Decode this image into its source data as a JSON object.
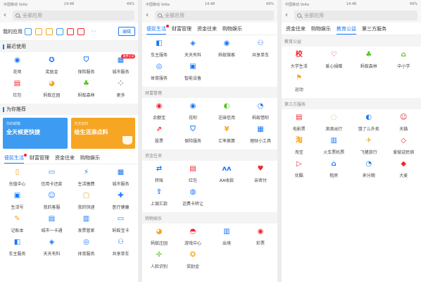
{
  "status": {
    "left": "中国移动 Volte",
    "time": "14:48",
    "right": "49%"
  },
  "search": {
    "placeholder": "全部应用",
    "back_glyph": "‹"
  },
  "panel1": {
    "my_apps": {
      "label": "我的应用",
      "mini_icons": [
        {
          "name": "bank-card-icon",
          "color": "#3d9bf1"
        },
        {
          "name": "transfer-icon",
          "color": "#f6a623"
        },
        {
          "name": "book-icon",
          "color": "#f6a623"
        },
        {
          "name": "card-icon",
          "color": "#3d9bf1"
        },
        {
          "name": "wallet-icon",
          "color": "#f5222d"
        },
        {
          "name": "heart-icon",
          "color": "#f5222d"
        }
      ],
      "more": "···",
      "edit": "编辑"
    },
    "recent": {
      "title": "最近使用",
      "items": [
        {
          "label": "花呗",
          "glyph": "◉",
          "color": "#1677ff",
          "icon": "huabei-icon"
        },
        {
          "label": "奖励金",
          "glyph": "✪",
          "color": "#1677ff",
          "icon": "reward-icon"
        },
        {
          "label": "保险服务",
          "glyph": "⛉",
          "color": "#1677ff",
          "icon": "insurance-shield-icon"
        },
        {
          "label": "城市服务",
          "glyph": "▦",
          "color": "#1677ff",
          "icon": "city-service-icon",
          "badge": "缴费记录"
        },
        {
          "label": "红包",
          "glyph": "▤",
          "color": "#f5222d",
          "icon": "red-packet-icon"
        },
        {
          "label": "蚂蚁庄园",
          "glyph": "◕",
          "color": "#f6a623",
          "icon": "ant-farm-icon"
        },
        {
          "label": "蚂蚁森林",
          "glyph": "♣",
          "color": "#52c41a",
          "icon": "ant-forest-icon"
        },
        {
          "label": "更多",
          "glyph": "⁘",
          "color": "#888888",
          "icon": "more-icon"
        }
      ]
    },
    "recommend": {
      "title": "为你推荐",
      "banners": [
        {
          "small": "你的邮箱",
          "big": "全天候更快捷"
        },
        {
          "small": "天天有料",
          "big": "给生活添点料"
        }
      ]
    },
    "tabs": [
      {
        "label": "便民生活",
        "active": true,
        "dot": true
      },
      {
        "label": "财富管理"
      },
      {
        "label": "资金往来"
      },
      {
        "label": "购物娱乐"
      }
    ],
    "grid": [
      {
        "label": "充值中心",
        "glyph": "▯",
        "color": "#f6a623",
        "icon": "phone-recharge-icon"
      },
      {
        "label": "信用卡还款",
        "glyph": "▭",
        "color": "#1677ff",
        "icon": "credit-card-icon"
      },
      {
        "label": "生活缴费",
        "glyph": "⚡",
        "color": "#1677ff",
        "icon": "utilities-icon"
      },
      {
        "label": "城市服务",
        "glyph": "▦",
        "color": "#1677ff",
        "icon": "city-service-icon"
      },
      {
        "label": "生活号",
        "glyph": "▣",
        "color": "#1677ff",
        "icon": "life-account-icon"
      },
      {
        "label": "我的客服",
        "glyph": "☺",
        "color": "#1677ff",
        "icon": "customer-service-icon"
      },
      {
        "label": "我的快递",
        "glyph": "▢",
        "color": "#f6a623",
        "icon": "express-icon"
      },
      {
        "label": "医疗健康",
        "glyph": "✚",
        "color": "#1677ff",
        "icon": "medical-icon"
      },
      {
        "label": "记账本",
        "glyph": "✎",
        "color": "#f6a623",
        "icon": "ledger-icon"
      },
      {
        "label": "城市一卡通",
        "glyph": "▤",
        "color": "#1677ff",
        "icon": "transit-card-icon"
      },
      {
        "label": "发票管家",
        "glyph": "▥",
        "color": "#1677ff",
        "icon": "invoice-icon"
      },
      {
        "label": "蚂蚁宝卡",
        "glyph": "▭",
        "color": "#1677ff",
        "icon": "ant-card-icon"
      },
      {
        "label": "车主服务",
        "glyph": "◧",
        "color": "#1677ff",
        "icon": "car-service-icon"
      },
      {
        "label": "天天有料",
        "glyph": "◈",
        "color": "#1677ff",
        "icon": "daily-news-icon"
      },
      {
        "label": "体育服务",
        "glyph": "◎",
        "color": "#1677ff",
        "icon": "sports-icon"
      },
      {
        "label": "共享单车",
        "glyph": "⚇",
        "color": "#1677ff",
        "icon": "bike-icon"
      }
    ]
  },
  "panel2": {
    "tabs": [
      {
        "label": "便民生活",
        "active": true,
        "dot": true
      },
      {
        "label": "财富管理"
      },
      {
        "label": "资金往来"
      },
      {
        "label": "购物娱乐"
      }
    ],
    "grid_top": [
      {
        "label": "车主服务",
        "glyph": "◧",
        "color": "#1677ff",
        "icon": "car-service-icon"
      },
      {
        "label": "天天有料",
        "glyph": "◈",
        "color": "#1677ff",
        "icon": "daily-news-icon"
      },
      {
        "label": "蚂蚁微客",
        "glyph": "◉",
        "color": "#1677ff",
        "icon": "ant-guest-icon"
      },
      {
        "label": "共享单车",
        "glyph": "⚇",
        "color": "#1677ff",
        "icon": "bike-icon"
      },
      {
        "label": "体育服务",
        "glyph": "◎",
        "color": "#1677ff",
        "icon": "sports-icon"
      },
      {
        "label": "智能设备",
        "glyph": "▣",
        "color": "#1677ff",
        "icon": "smart-device-icon"
      }
    ],
    "wealth": {
      "title": "财富管理",
      "items": [
        {
          "label": "余额宝",
          "glyph": "◉",
          "color": "#f5222d",
          "icon": "yuebao-icon"
        },
        {
          "label": "花呗",
          "glyph": "◉",
          "color": "#1677ff",
          "icon": "huabei-icon"
        },
        {
          "label": "芝麻信用",
          "glyph": "◐",
          "color": "#52c41a",
          "icon": "sesame-credit-icon"
        },
        {
          "label": "蚂蚁借呗",
          "glyph": "◔",
          "color": "#1677ff",
          "icon": "jiebei-icon"
        },
        {
          "label": "股票",
          "glyph": "⇗",
          "color": "#f5222d",
          "icon": "stock-icon"
        },
        {
          "label": "保险服务",
          "glyph": "⛉",
          "color": "#1677ff",
          "icon": "insurance-shield-icon"
        },
        {
          "label": "汇率换算",
          "glyph": "¥",
          "color": "#f6a623",
          "icon": "exchange-rate-icon"
        },
        {
          "label": "理财小工具",
          "glyph": "▦",
          "color": "#1677ff",
          "icon": "finance-tools-icon"
        }
      ]
    },
    "funds": {
      "title": "资金往来",
      "items": [
        {
          "label": "转账",
          "glyph": "⇄",
          "color": "#1677ff",
          "icon": "transfer-icon"
        },
        {
          "label": "红包",
          "glyph": "▤",
          "color": "#f5222d",
          "icon": "red-packet-icon"
        },
        {
          "label": "AA收款",
          "glyph": "ʌʌ",
          "color": "#1677ff",
          "icon": "aa-collect-icon"
        },
        {
          "label": "亲密付",
          "glyph": "♥",
          "color": "#f5222d",
          "icon": "intimate-pay-icon"
        },
        {
          "label": "上银汇款",
          "glyph": "⇪",
          "color": "#1677ff",
          "icon": "bank-remit-icon"
        },
        {
          "label": "话费卡转让",
          "glyph": "◍",
          "color": "#1677ff",
          "icon": "phone-card-icon"
        }
      ]
    },
    "shopping": {
      "title": "购物娱乐",
      "items": [
        {
          "label": "蚂蚁庄园",
          "glyph": "◕",
          "color": "#f6a623",
          "icon": "ant-farm-icon"
        },
        {
          "label": "游戏中心",
          "glyph": "◓",
          "color": "#f5222d",
          "icon": "game-center-icon"
        },
        {
          "label": "出境",
          "glyph": "▥",
          "color": "#1677ff",
          "icon": "travel-abroad-icon"
        },
        {
          "label": "彩票",
          "glyph": "◉",
          "color": "#f5222d",
          "icon": "lottery-icon"
        },
        {
          "label": "人脸识别",
          "glyph": "✢",
          "color": "#52c41a",
          "icon": "face-recognition-icon"
        },
        {
          "label": "奖励金",
          "glyph": "✪",
          "color": "#f6a623",
          "icon": "reward-icon"
        }
      ]
    }
  },
  "panel3": {
    "tabs": [
      {
        "label": "资金往来"
      },
      {
        "label": "购物娱乐"
      },
      {
        "label": "教育公益",
        "active": true
      },
      {
        "label": "第三方服务"
      }
    ],
    "education": {
      "title": "教育公益",
      "items": [
        {
          "label": "大学生活",
          "glyph": "校",
          "color": "#f5222d",
          "icon": "university-icon"
        },
        {
          "label": "爱心捐赠",
          "glyph": "♡",
          "color": "#f5222d",
          "icon": "donation-icon"
        },
        {
          "label": "蚂蚁森林",
          "glyph": "♣",
          "color": "#52c41a",
          "icon": "ant-forest-icon"
        },
        {
          "label": "中小学",
          "glyph": "⌂",
          "color": "#52c41a",
          "icon": "school-icon"
        },
        {
          "label": "运动",
          "glyph": "⚑",
          "color": "#f6a623",
          "icon": "sports-flag-icon"
        }
      ]
    },
    "thirdparty": {
      "title": "第三方服务",
      "items": [
        {
          "label": "电影票",
          "glyph": "▤",
          "color": "#f5222d",
          "icon": "movie-ticket-icon"
        },
        {
          "label": "滴滴出行",
          "glyph": "◌",
          "color": "#f6a623",
          "icon": "didi-icon"
        },
        {
          "label": "饿了么外卖",
          "glyph": "◐",
          "color": "#1677ff",
          "icon": "eleme-icon"
        },
        {
          "label": "天猫",
          "glyph": "☺",
          "color": "#f5222d",
          "icon": "tmall-icon"
        },
        {
          "label": "淘宝",
          "glyph": "淘",
          "color": "#f6a623",
          "icon": "taobao-icon"
        },
        {
          "label": "火车票机票",
          "glyph": "▥",
          "color": "#1677ff",
          "icon": "train-ticket-icon"
        },
        {
          "label": "飞猪旅行",
          "glyph": "✈",
          "color": "#f6a623",
          "icon": "fliggy-icon"
        },
        {
          "label": "爱彼迎民宿",
          "glyph": "◇",
          "color": "#f5222d",
          "icon": "homestay-icon"
        },
        {
          "label": "优酷",
          "glyph": "▷",
          "color": "#f5222d",
          "icon": "youku-icon"
        },
        {
          "label": "租房",
          "glyph": "⌂",
          "color": "#1677ff",
          "icon": "rent-icon"
        },
        {
          "label": "来分期",
          "glyph": "◔",
          "color": "#1677ff",
          "icon": "installment-icon"
        },
        {
          "label": "大麦",
          "glyph": "◆",
          "color": "#f5222d",
          "icon": "damai-icon"
        }
      ]
    }
  }
}
